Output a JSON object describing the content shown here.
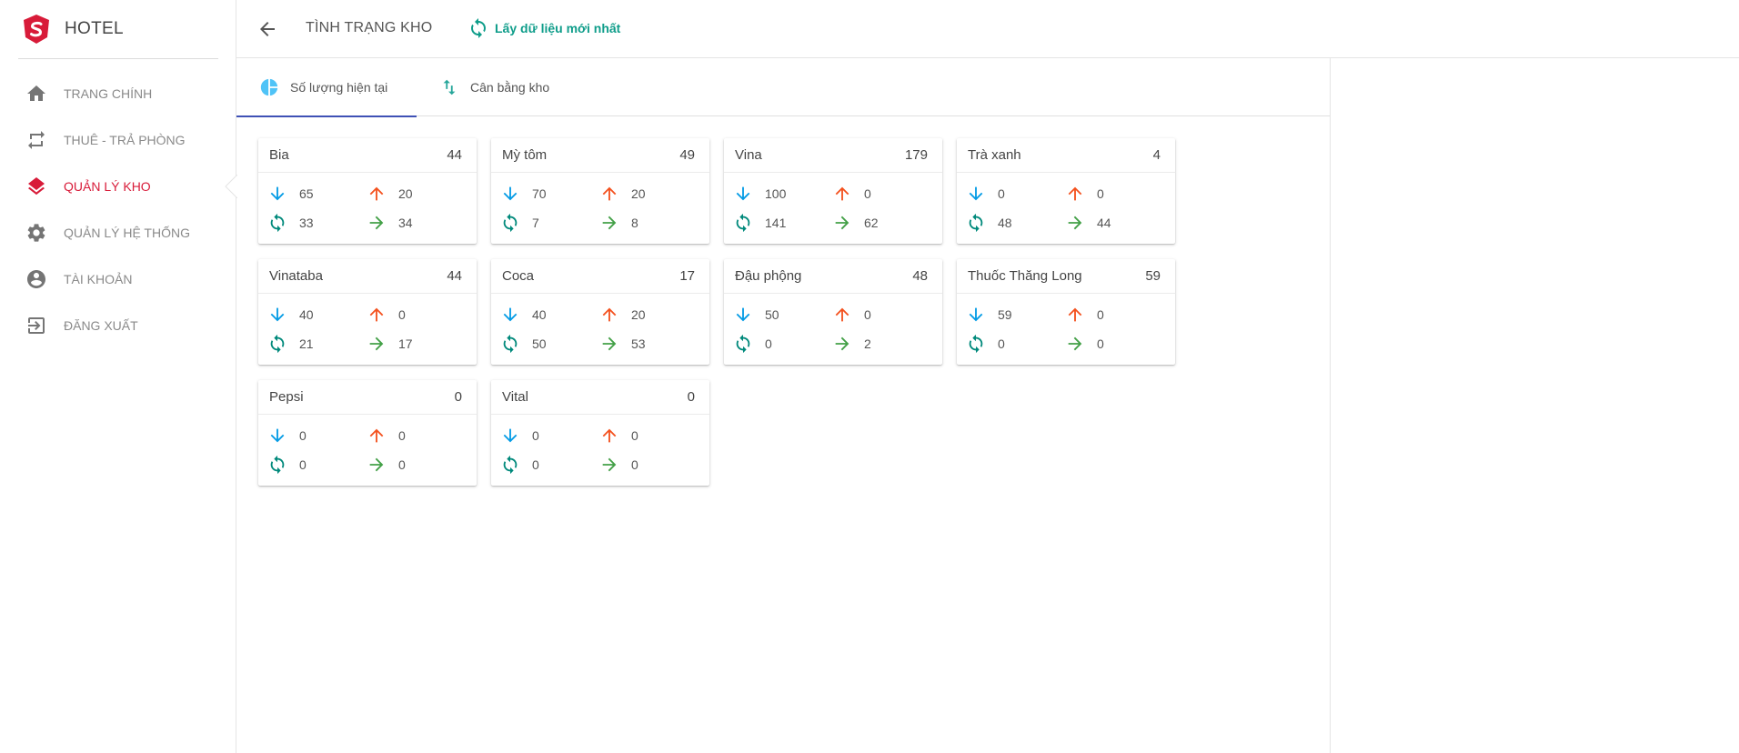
{
  "app": {
    "name": "HOTEL",
    "brand_color": "#d81b39"
  },
  "sidebar": {
    "items": [
      {
        "label": "TRANG CHÍNH",
        "icon": "home-icon",
        "active": false
      },
      {
        "label": "THUÊ - TRẢ PHÒNG",
        "icon": "repeat-icon",
        "active": false
      },
      {
        "label": "QUẢN LÝ KHO",
        "icon": "layers-icon",
        "active": true
      },
      {
        "label": "QUẢN LÝ HỆ THỐNG",
        "icon": "gear-icon",
        "active": false
      },
      {
        "label": "TÀI KHOẢN",
        "icon": "account-icon",
        "active": false
      },
      {
        "label": "ĐĂNG XUẤT",
        "icon": "logout-icon",
        "active": false
      }
    ]
  },
  "header": {
    "title": "TÌNH TRẠNG KHO",
    "refresh_label": "Lấy dữ liệu mới nhất"
  },
  "tabs": [
    {
      "label": "Số lượng hiện tại",
      "icon": "pie-chart-icon",
      "active": true
    },
    {
      "label": "Cân bằng kho",
      "icon": "swap-vertical-icon",
      "active": false
    }
  ],
  "colors": {
    "in": "#039be5",
    "out": "#f4511e",
    "cycle": "#00897b",
    "move": "#43a047",
    "tab_indicator": "#3f51b5",
    "refresh": "#0f9d8a"
  },
  "items": [
    {
      "name": "Bia",
      "total": "44",
      "in": "65",
      "out": "20",
      "cycle": "33",
      "move": "34"
    },
    {
      "name": "Mỳ tôm",
      "total": "49",
      "in": "70",
      "out": "20",
      "cycle": "7",
      "move": "8"
    },
    {
      "name": "Vina",
      "total": "179",
      "in": "100",
      "out": "0",
      "cycle": "141",
      "move": "62"
    },
    {
      "name": "Trà xanh",
      "total": "4",
      "in": "0",
      "out": "0",
      "cycle": "48",
      "move": "44"
    },
    {
      "name": "Vinataba",
      "total": "44",
      "in": "40",
      "out": "0",
      "cycle": "21",
      "move": "17"
    },
    {
      "name": "Coca",
      "total": "17",
      "in": "40",
      "out": "20",
      "cycle": "50",
      "move": "53"
    },
    {
      "name": "Đậu phộng",
      "total": "48",
      "in": "50",
      "out": "0",
      "cycle": "0",
      "move": "2"
    },
    {
      "name": "Thuốc Thăng Long",
      "total": "59",
      "in": "59",
      "out": "0",
      "cycle": "0",
      "move": "0"
    },
    {
      "name": "Pepsi",
      "total": "0",
      "in": "0",
      "out": "0",
      "cycle": "0",
      "move": "0"
    },
    {
      "name": "Vital",
      "total": "0",
      "in": "0",
      "out": "0",
      "cycle": "0",
      "move": "0"
    }
  ]
}
